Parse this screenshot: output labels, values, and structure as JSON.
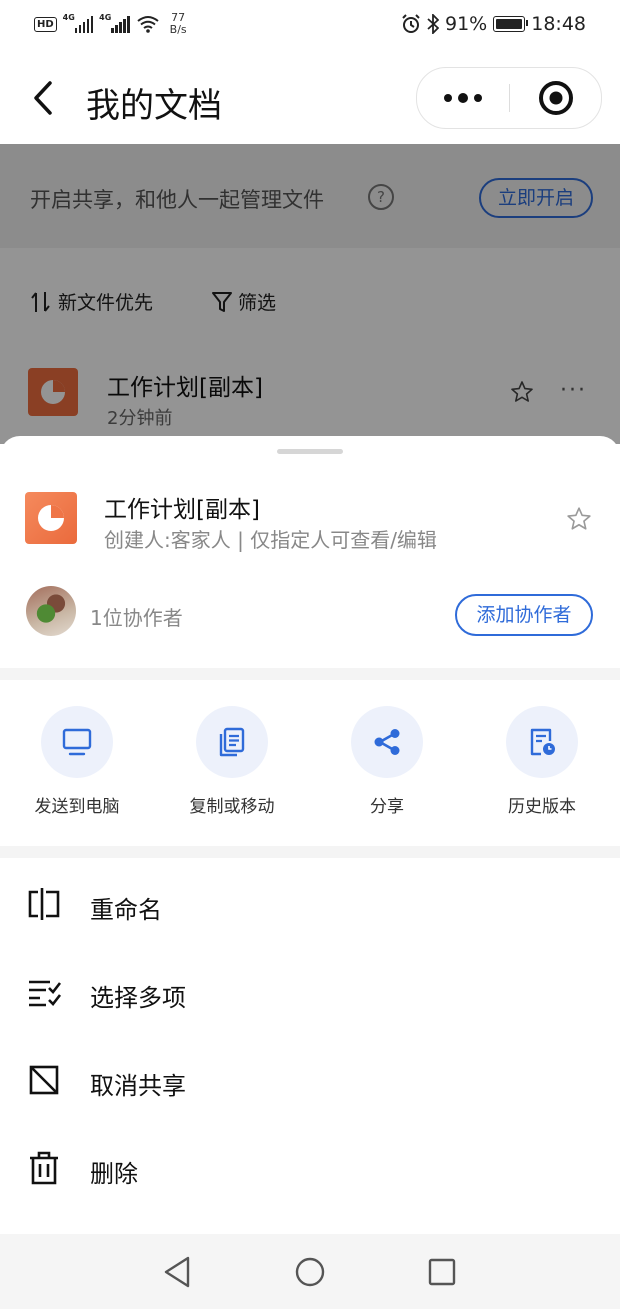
{
  "status_bar": {
    "hd": "HD",
    "sim1": "4G",
    "sim2": "4G",
    "net_speed": "77",
    "net_unit": "B/s",
    "battery": "91%",
    "time": "18:48"
  },
  "nav": {
    "title": "我的文档"
  },
  "background_page": {
    "banner_text": "开启共享，和他人一起管理文件",
    "help_mark": "?",
    "enable_label": "立即开启",
    "sort_label": "新文件优先",
    "filter_label": "筛选",
    "file_name": "工作计划[副本]",
    "file_time": "2分钟前",
    "more": "···"
  },
  "sheet": {
    "file_name": "工作计划[副本]",
    "file_meta": "创建人:客家人 | 仅指定人可查看/编辑",
    "collaborators": "1位协作者",
    "add_collaborator": "添加协作者",
    "actions": [
      {
        "label": "发送到电脑",
        "icon": "monitor-icon"
      },
      {
        "label": "复制或移动",
        "icon": "copy-icon"
      },
      {
        "label": "分享",
        "icon": "share-icon"
      },
      {
        "label": "历史版本",
        "icon": "history-icon"
      }
    ],
    "menu": [
      {
        "label": "重命名",
        "icon": "rename-icon"
      },
      {
        "label": "选择多项",
        "icon": "multi-select-icon"
      },
      {
        "label": "取消共享",
        "icon": "unshare-icon"
      },
      {
        "label": "删除",
        "icon": "trash-icon"
      }
    ]
  },
  "colors": {
    "accent": "#2f6bd9",
    "file_orange": "#ee6d3f",
    "action_bg": "#edf1fb"
  }
}
